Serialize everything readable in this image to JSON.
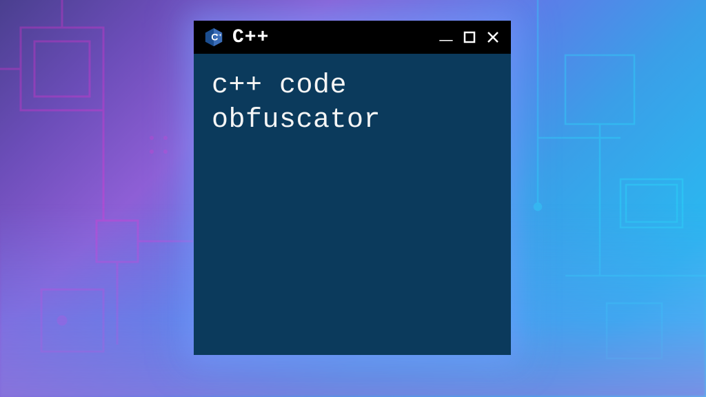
{
  "window": {
    "title": "C++",
    "icon_label": "C++",
    "content_line1": "c++ code",
    "content_line2": "obfuscator"
  },
  "colors": {
    "content_bg": "#0b3a5c",
    "titlebar_bg": "#000000",
    "text": "#f5f5f5"
  }
}
